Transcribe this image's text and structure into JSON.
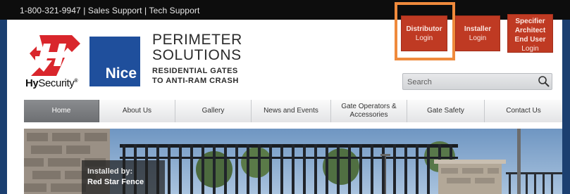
{
  "topbar": {
    "phone": "1-800-321-9947",
    "sales": "Sales Support",
    "tech": "Tech Support",
    "separator": " | "
  },
  "branding": {
    "hy": "Hy",
    "security": "Security",
    "nice": "Nice",
    "tagline_1": "PERIMETER",
    "tagline_2": "SOLUTIONS",
    "tagline_3": "RESIDENTIAL GATES",
    "tagline_4": "TO ANTI-RAM CRASH"
  },
  "logins": [
    {
      "title": "Distributor",
      "sub": "Login"
    },
    {
      "title": "Installer",
      "sub": "Login"
    },
    {
      "title_1": "Specifier",
      "title_2": "Architect",
      "title_3": "End User",
      "sub": "Login"
    }
  ],
  "search": {
    "placeholder": "Search"
  },
  "nav": [
    {
      "label": "Home",
      "active": true
    },
    {
      "label": "About Us"
    },
    {
      "label": "Gallery"
    },
    {
      "label": "News and Events"
    },
    {
      "label_1": "Gate Operators &",
      "label_2": "Accessories"
    },
    {
      "label": "Gate Safety"
    },
    {
      "label": "Contact Us"
    }
  ],
  "hero": {
    "caption_1": "Installed by:",
    "caption_2": "Red Star Fence"
  },
  "colors": {
    "login_red": "#bf3a23",
    "highlight_orange": "#ef8a3c",
    "nice_blue": "#1f4f9c",
    "brand_red": "#d9262c"
  }
}
